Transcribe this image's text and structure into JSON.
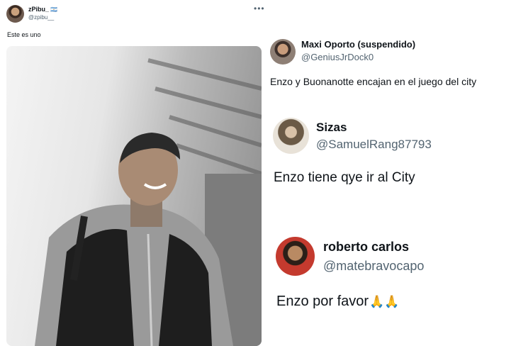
{
  "main_tweet": {
    "author_name": "zPibu_",
    "author_flag": "🇦🇷",
    "author_handle": "@zpibu__",
    "more_icon": "more-horizontal-icon",
    "text": "Este es uno",
    "photo_icon": "player-photo"
  },
  "quoted": [
    {
      "name": "Maxi Oporto (suspendido)",
      "handle": "@GeniusJrDock0",
      "text": "Enzo y Buonanotte encajan en el juego del city"
    },
    {
      "name": "Sizas",
      "handle": "@SamuelRang87793",
      "text": "Enzo tiene qye ir al City"
    },
    {
      "name": "roberto carlos",
      "handle": "@matebravocapo",
      "text": "Enzo por favor",
      "emoji": "🙏🙏"
    }
  ],
  "colors": {
    "text_primary": "#0f1419",
    "text_secondary": "#536471",
    "background": "#ffffff"
  }
}
